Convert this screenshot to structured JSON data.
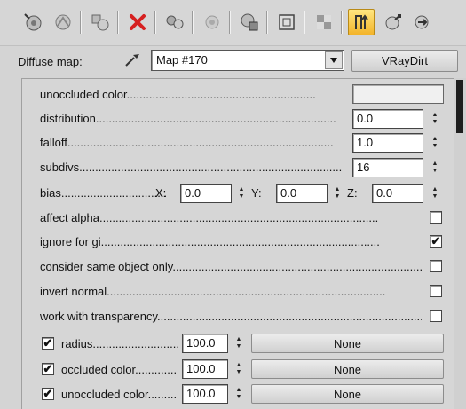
{
  "toolbar": {
    "icons": [
      "pick-material-icon",
      "put-to-scene-icon",
      "assign-to-selection-icon",
      "delete-icon",
      "make-unique-icon",
      "put-to-library-icon",
      "material-id-icon",
      "show-map-in-viewport-icon",
      "show-background-icon",
      "show-end-result-icon",
      "go-to-parent-icon",
      "go-forward-to-sibling-icon"
    ]
  },
  "diffuse": {
    "label": "Diffuse map:",
    "map_name": "Map #170",
    "map_type": "VRayDirt"
  },
  "params": {
    "unoccluded_color": "unoccluded color",
    "distribution": {
      "label": "distribution",
      "value": "0.0"
    },
    "falloff": {
      "label": "falloff",
      "value": "1.0"
    },
    "subdivs": {
      "label": "subdivs",
      "value": "16"
    },
    "bias": {
      "label": "bias",
      "x_label": "X:",
      "x": "0.0",
      "y_label": "Y:",
      "y": "0.0",
      "z_label": "Z:",
      "z": "0.0"
    },
    "checks": [
      {
        "label": "affect alpha",
        "checked": false
      },
      {
        "label": "ignore for gi",
        "checked": true
      },
      {
        "label": "consider same object only",
        "checked": false
      },
      {
        "label": "invert normal",
        "checked": false
      },
      {
        "label": "work with transparency",
        "checked": false
      }
    ],
    "maps": [
      {
        "label": "radius",
        "checked": true,
        "value": "100.0",
        "map": "None"
      },
      {
        "label": "occluded color",
        "checked": true,
        "value": "100.0",
        "map": "None"
      },
      {
        "label": "unoccluded color",
        "checked": true,
        "value": "100.0",
        "map": "None"
      }
    ]
  }
}
